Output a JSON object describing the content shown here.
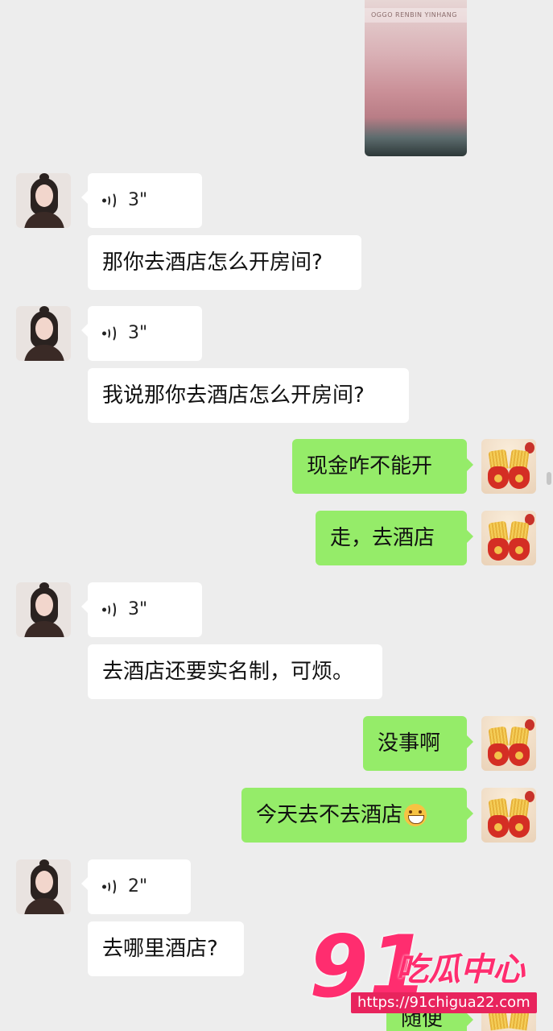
{
  "top_image": {
    "caption_text": "OGGO RENBIN YINHANG"
  },
  "messages": [
    {
      "side": "left",
      "type": "voice",
      "duration": "3\""
    },
    {
      "side": "left",
      "type": "text",
      "text": "那你去酒店怎么开房间?"
    },
    {
      "side": "left",
      "type": "voice",
      "duration": "3\""
    },
    {
      "side": "left",
      "type": "text",
      "text": "我说那你去酒店怎么开房间?"
    },
    {
      "side": "right",
      "type": "text",
      "text": "现金咋不能开"
    },
    {
      "side": "right",
      "type": "text",
      "text": "走，去酒店"
    },
    {
      "side": "left",
      "type": "voice",
      "duration": "3\""
    },
    {
      "side": "left",
      "type": "text",
      "text": "去酒店还要实名制，可烦。"
    },
    {
      "side": "right",
      "type": "text",
      "text": "没事啊"
    },
    {
      "side": "right",
      "type": "text",
      "text": "今天去不去酒店",
      "emoji": "grinning-face"
    },
    {
      "side": "left",
      "type": "voice",
      "duration": "2\""
    },
    {
      "side": "left",
      "type": "text",
      "text": "去哪里酒店?"
    },
    {
      "side": "right",
      "type": "text",
      "text": "随便"
    }
  ],
  "watermark": {
    "number": "91",
    "brand": "吃瓜中心",
    "url": "https://91chigua22.com"
  },
  "colors": {
    "background": "#ededed",
    "bubble_left": "#ffffff",
    "bubble_right": "#95ec69",
    "watermark": "#ff2d6f"
  }
}
